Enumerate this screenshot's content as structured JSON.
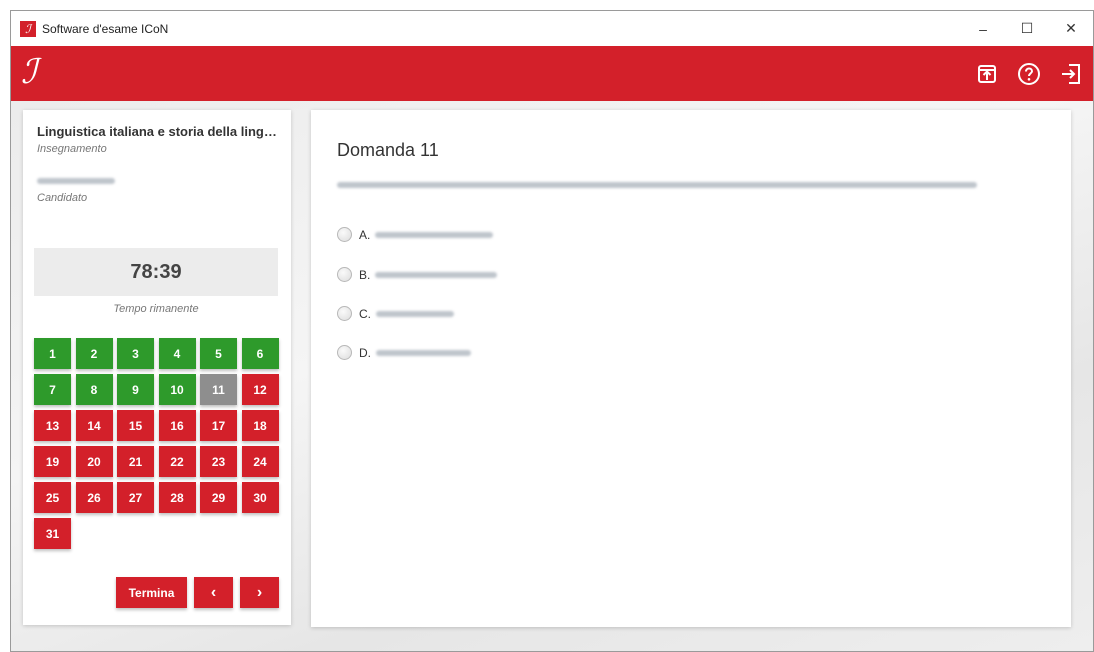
{
  "window": {
    "title": "Software d'esame ICoN",
    "controls": {
      "minimize": "–",
      "maximize": "☐",
      "close": "✕"
    }
  },
  "appbar": {
    "logo_glyph": "ℐ",
    "actions": [
      {
        "name": "upload-icon"
      },
      {
        "name": "help-icon"
      },
      {
        "name": "exit-icon"
      }
    ],
    "brand_color": "#d3202a"
  },
  "sidebar": {
    "course_title": "Linguistica italiana e storia della lingua...",
    "course_label": "Insegnamento",
    "candidate_label": "Candidato",
    "timer": "78:39",
    "timer_caption": "Tempo rimanente",
    "questions": [
      {
        "n": "1",
        "status": "answered"
      },
      {
        "n": "2",
        "status": "answered"
      },
      {
        "n": "3",
        "status": "answered"
      },
      {
        "n": "4",
        "status": "answered"
      },
      {
        "n": "5",
        "status": "answered"
      },
      {
        "n": "6",
        "status": "answered"
      },
      {
        "n": "7",
        "status": "answered"
      },
      {
        "n": "8",
        "status": "answered"
      },
      {
        "n": "9",
        "status": "answered"
      },
      {
        "n": "10",
        "status": "answered"
      },
      {
        "n": "11",
        "status": "current"
      },
      {
        "n": "12",
        "status": "unanswered"
      },
      {
        "n": "13",
        "status": "unanswered"
      },
      {
        "n": "14",
        "status": "unanswered"
      },
      {
        "n": "15",
        "status": "unanswered"
      },
      {
        "n": "16",
        "status": "unanswered"
      },
      {
        "n": "17",
        "status": "unanswered"
      },
      {
        "n": "18",
        "status": "unanswered"
      },
      {
        "n": "19",
        "status": "unanswered"
      },
      {
        "n": "20",
        "status": "unanswered"
      },
      {
        "n": "21",
        "status": "unanswered"
      },
      {
        "n": "22",
        "status": "unanswered"
      },
      {
        "n": "23",
        "status": "unanswered"
      },
      {
        "n": "24",
        "status": "unanswered"
      },
      {
        "n": "25",
        "status": "unanswered"
      },
      {
        "n": "26",
        "status": "unanswered"
      },
      {
        "n": "27",
        "status": "unanswered"
      },
      {
        "n": "28",
        "status": "unanswered"
      },
      {
        "n": "29",
        "status": "unanswered"
      },
      {
        "n": "30",
        "status": "unanswered"
      },
      {
        "n": "31",
        "status": "unanswered"
      }
    ],
    "finish_label": "Termina",
    "prev_label": "‹",
    "next_label": "›",
    "status_colors": {
      "answered": "#2e9a2b",
      "unanswered": "#d3202a",
      "current": "#8e8e8e"
    }
  },
  "question": {
    "title": "Domanda 11",
    "options": [
      {
        "letter": "A."
      },
      {
        "letter": "B."
      },
      {
        "letter": "C."
      },
      {
        "letter": "D."
      }
    ]
  }
}
